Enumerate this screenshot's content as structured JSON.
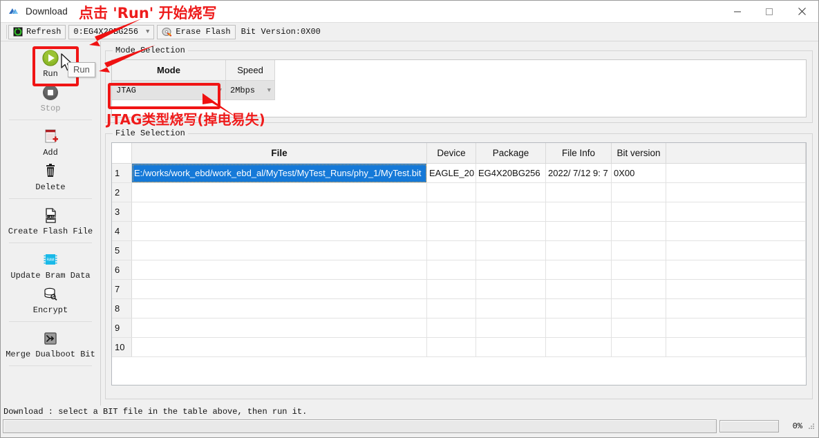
{
  "window": {
    "title": "Download",
    "icon": "app-logo-icon",
    "minimize_label": "—",
    "maximize_label": "□",
    "close_label": "✕"
  },
  "toolbar": {
    "refresh_label": "Refresh",
    "device_combo_value": "0:EG4X20BG256",
    "erase_label": "Erase Flash",
    "bit_version_label": "Bit Version:0X00"
  },
  "sidebar": {
    "items": [
      {
        "label": "Run",
        "icon": "play-icon",
        "enabled": true
      },
      {
        "label": "Stop",
        "icon": "stop-icon",
        "enabled": false
      },
      {
        "label": "Add",
        "icon": "add-file-icon",
        "enabled": true
      },
      {
        "label": "Delete",
        "icon": "trash-icon",
        "enabled": true
      },
      {
        "label": "Create Flash File",
        "icon": "flash-file-icon",
        "enabled": true
      },
      {
        "label": "Update Bram Data",
        "icon": "ram-chip-icon",
        "enabled": true
      },
      {
        "label": "Encrypt",
        "icon": "database-key-icon",
        "enabled": true
      },
      {
        "label": "Merge Dualboot Bit",
        "icon": "merge-arrow-icon",
        "enabled": true
      }
    ]
  },
  "mode_selection": {
    "legend": "Mode Selection",
    "columns": [
      "Mode",
      "Speed"
    ],
    "mode_value": "JTAG",
    "speed_value": "2Mbps"
  },
  "file_selection": {
    "legend": "File Selection",
    "columns": [
      "File",
      "Device",
      "Package",
      "File Info",
      "Bit version"
    ],
    "rows": [
      {
        "n": "1",
        "file": "E:/works/work_ebd/work_ebd_al/MyTest/MyTest_Runs/phy_1/MyTest.bit",
        "device": "EAGLE_20",
        "package": "EG4X20BG256",
        "file_info": "2022/ 7/12  9: 7",
        "bit_version": "0X00",
        "selected": true
      },
      {
        "n": "2",
        "file": "",
        "device": "",
        "package": "",
        "file_info": "",
        "bit_version": "",
        "selected": false
      },
      {
        "n": "3",
        "file": "",
        "device": "",
        "package": "",
        "file_info": "",
        "bit_version": "",
        "selected": false
      },
      {
        "n": "4",
        "file": "",
        "device": "",
        "package": "",
        "file_info": "",
        "bit_version": "",
        "selected": false
      },
      {
        "n": "5",
        "file": "",
        "device": "",
        "package": "",
        "file_info": "",
        "bit_version": "",
        "selected": false
      },
      {
        "n": "6",
        "file": "",
        "device": "",
        "package": "",
        "file_info": "",
        "bit_version": "",
        "selected": false
      },
      {
        "n": "7",
        "file": "",
        "device": "",
        "package": "",
        "file_info": "",
        "bit_version": "",
        "selected": false
      },
      {
        "n": "8",
        "file": "",
        "device": "",
        "package": "",
        "file_info": "",
        "bit_version": "",
        "selected": false
      },
      {
        "n": "9",
        "file": "",
        "device": "",
        "package": "",
        "file_info": "",
        "bit_version": "",
        "selected": false
      },
      {
        "n": "10",
        "file": "",
        "device": "",
        "package": "",
        "file_info": "",
        "bit_version": "",
        "selected": false
      }
    ]
  },
  "statusbar": {
    "message": "Download : select a BIT file in the table above, then run it.",
    "progress_percent": "0%"
  },
  "tooltip": {
    "text": "Run"
  },
  "annotations": [
    {
      "id": "anno-top",
      "text": "点击 'Run' 开始烧写"
    },
    {
      "id": "anno-jtag",
      "text": "JTAG类型烧写(掉电易失)"
    }
  ],
  "colors": {
    "annotation_red": "#ee1b1b",
    "selection_blue": "#1579d8",
    "window_bg": "#f0f0f0",
    "run_green": "#8cb827"
  }
}
